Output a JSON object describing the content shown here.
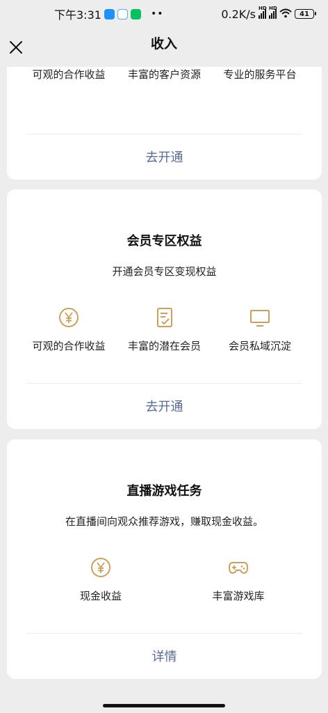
{
  "status_bar": {
    "time": "下午3:31",
    "net_speed": "0.2K/s",
    "hd_label": "HD",
    "battery": "41",
    "app_icon_colors": [
      "#1e90ff",
      "#5aa9e6",
      "#07c160"
    ]
  },
  "header": {
    "title": "收入"
  },
  "card_partial": {
    "benefits": [
      {
        "icon": "plus-circle-icon",
        "label": "可观的合作收益"
      },
      {
        "icon": "handshake-icon",
        "label": "丰富的客户资源"
      },
      {
        "icon": "monitor-icon",
        "label": "专业的服务平台"
      }
    ],
    "action": "去开通"
  },
  "card_member": {
    "title": "会员专区权益",
    "subtitle": "开通会员专区变现权益",
    "benefits": [
      {
        "icon": "yen-circle-icon",
        "label": "可观的合作收益"
      },
      {
        "icon": "document-check-icon",
        "label": "丰富的潜在会员"
      },
      {
        "icon": "monitor-icon",
        "label": "会员私域沉淀"
      }
    ],
    "action": "去开通"
  },
  "card_game": {
    "title": "直播游戏任务",
    "subtitle": "在直播间向观众推荐游戏，赚取现金收益。",
    "benefits": [
      {
        "icon": "yen-circle-icon",
        "label": "现金收益"
      },
      {
        "icon": "gamepad-icon",
        "label": "丰富游戏库"
      }
    ],
    "action": "详情"
  },
  "colors": {
    "accent_gold": "#c9a05c",
    "link_blue": "#576b95",
    "card_bg": "#ffffff",
    "page_bg": "#ededed"
  }
}
